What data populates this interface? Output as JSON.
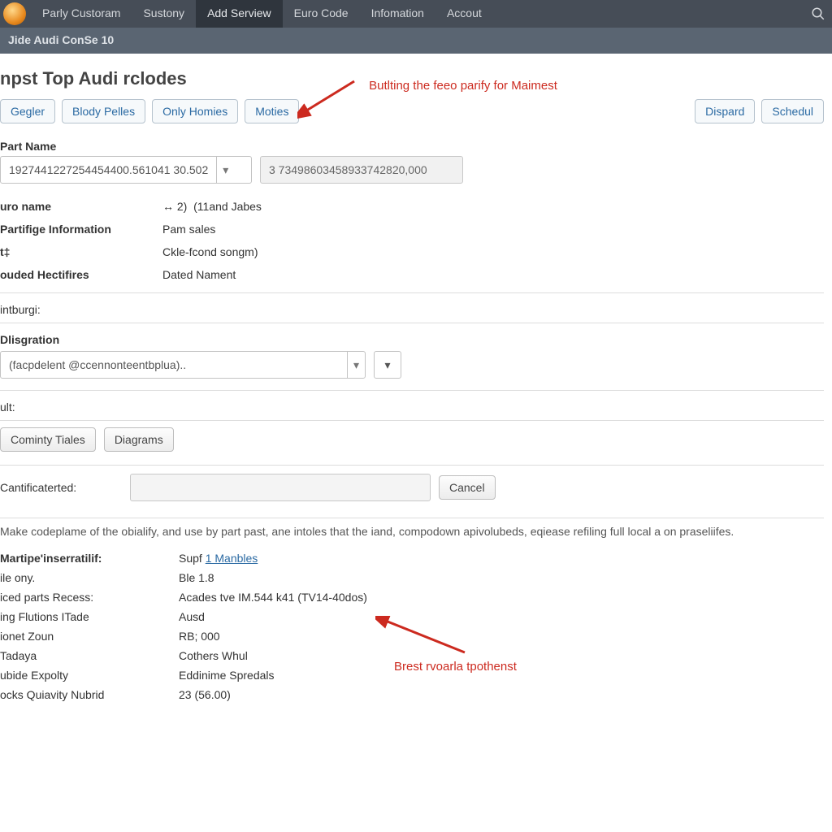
{
  "topnav": {
    "items": [
      "Parly Custoram",
      "Sustony",
      "Add Serview",
      "Euro Code",
      "Infomation",
      "Accout"
    ],
    "active_index": 2
  },
  "subbar": {
    "title": "Jide Audi ConSe 10"
  },
  "page": {
    "title": "npst Top Audi rclodes"
  },
  "filters": {
    "b0": "Gegler",
    "b1": "Blody Pelles",
    "b2": "Only Homies",
    "b3": "Moties"
  },
  "right_actions": {
    "dispard": "Dispard",
    "schedule": "Schedul"
  },
  "annot": {
    "top": "Butlting the feeo parify for Maimest",
    "bottom": "Brest rvoarla tpothenst"
  },
  "part": {
    "label": "Part Name",
    "select_value": "1927441227254454400.561041 30.502",
    "readonly_value": "3 73498603458933742820,000"
  },
  "details": {
    "euro_name_k": "uro name",
    "euro_name_icon": "↔ 2)",
    "euro_name_v": "(11and Jabes",
    "partifige_k": "Partifige Information",
    "partifige_v": "Pam sales",
    "star_k": "t‡",
    "star_v": "Ckle-fcond songm)",
    "hect_k": "ouded Hectifires",
    "hect_v": "Dated Nament"
  },
  "intburgi": {
    "label": "intburgi:",
    "section": "Dlisgration",
    "value": "(facpdelent @ccennonteentbplua)..",
    "ult": "ult:"
  },
  "buttons": {
    "cominty": "Cominty Tiales",
    "diagrams": "Diagrams"
  },
  "cert": {
    "label": "Cantificaterted:",
    "cancel": "Cancel"
  },
  "note": {
    "text": "Make codeplame of the obialify, and use by part past, ane intoles that the iand, compodown apivolubeds, eqiease refiling full local a on praseliifes."
  },
  "bottom": {
    "r0k": "Martipe'inserratilif:",
    "r0v_pre": "Supf ",
    "r0v_link": "1 Manbles",
    "r1k": "ile ony.",
    "r1v": "Ble 1.8",
    "r2k": "iced parts Recess:",
    "r2v": "Acades tve IM.544 k41 (TV14-40dos)",
    "r3k": "ing Flutions ITade",
    "r3v": "Ausd",
    "r4k": "ionet Zoun",
    "r4v": "RB; 000",
    "r5k": "Tadaya",
    "r5v": "Cothers Whul",
    "r6k": "ubide Expolty",
    "r6v": "Eddinime Spredals",
    "r7k": "ocks Quiavity Nubrid",
    "r7v": "23 (56.00)"
  }
}
